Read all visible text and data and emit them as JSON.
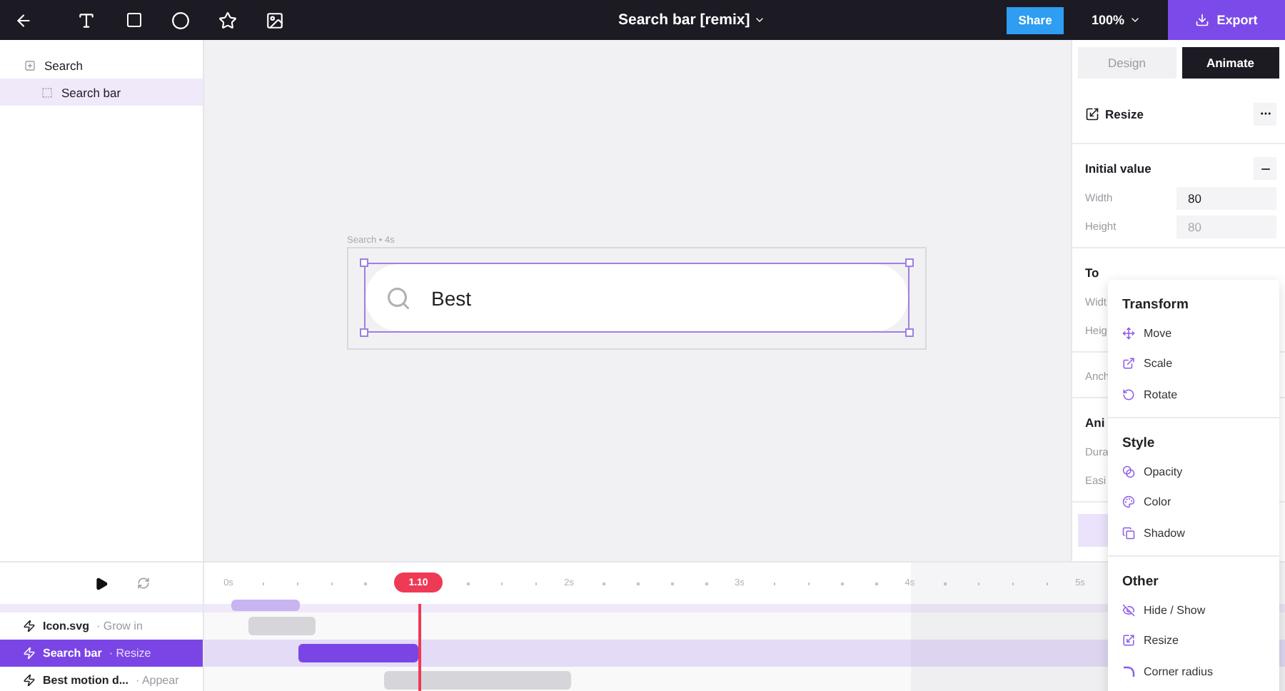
{
  "toolbar": {
    "title": "Search bar [remix]",
    "share": "Share",
    "zoom": "100%",
    "export": "Export"
  },
  "layers": [
    {
      "label": "Search",
      "selected": false,
      "children": [
        {
          "label": "Search bar",
          "selected": true
        }
      ]
    }
  ],
  "canvas": {
    "frame_label": "Search • 4s",
    "search_text": "Best"
  },
  "panel": {
    "tabs": [
      {
        "label": "Design",
        "selected": false
      },
      {
        "label": "Animate",
        "selected": true
      }
    ],
    "header": "Resize",
    "sections": [
      {
        "title": "Initial value",
        "collapsible": true,
        "fields": [
          {
            "label": "Width",
            "value": "80",
            "disabled": false
          },
          {
            "label": "Height",
            "value": "80",
            "disabled": true
          }
        ]
      },
      {
        "title": "To",
        "fields": [
          {
            "label": "Widt"
          },
          {
            "label": "Heig"
          }
        ]
      },
      {
        "fields": [
          {
            "label": "Anch"
          }
        ]
      },
      {
        "title": "Ani",
        "fields": [
          {
            "label": "Dura"
          },
          {
            "label": "Easi"
          }
        ]
      }
    ]
  },
  "timeline": {
    "playhead": "1.10",
    "ruler": [
      "0s",
      "2s",
      "3s",
      "4s",
      "5s"
    ],
    "tracks": [
      {
        "name": "Icon.svg",
        "action": "· Grow in",
        "selected": false
      },
      {
        "name": "Search bar",
        "action": "· Resize",
        "selected": true
      },
      {
        "name": "Best motion d...",
        "action": "· Appear",
        "selected": false
      }
    ]
  },
  "menu": {
    "sections": [
      {
        "title": "Transform",
        "items": [
          "Move",
          "Scale",
          "Rotate"
        ]
      },
      {
        "title": "Style",
        "items": [
          "Opacity",
          "Color",
          "Shadow"
        ]
      },
      {
        "title": "Other",
        "items": [
          "Hide / Show",
          "Resize",
          "Corner radius"
        ]
      }
    ]
  }
}
